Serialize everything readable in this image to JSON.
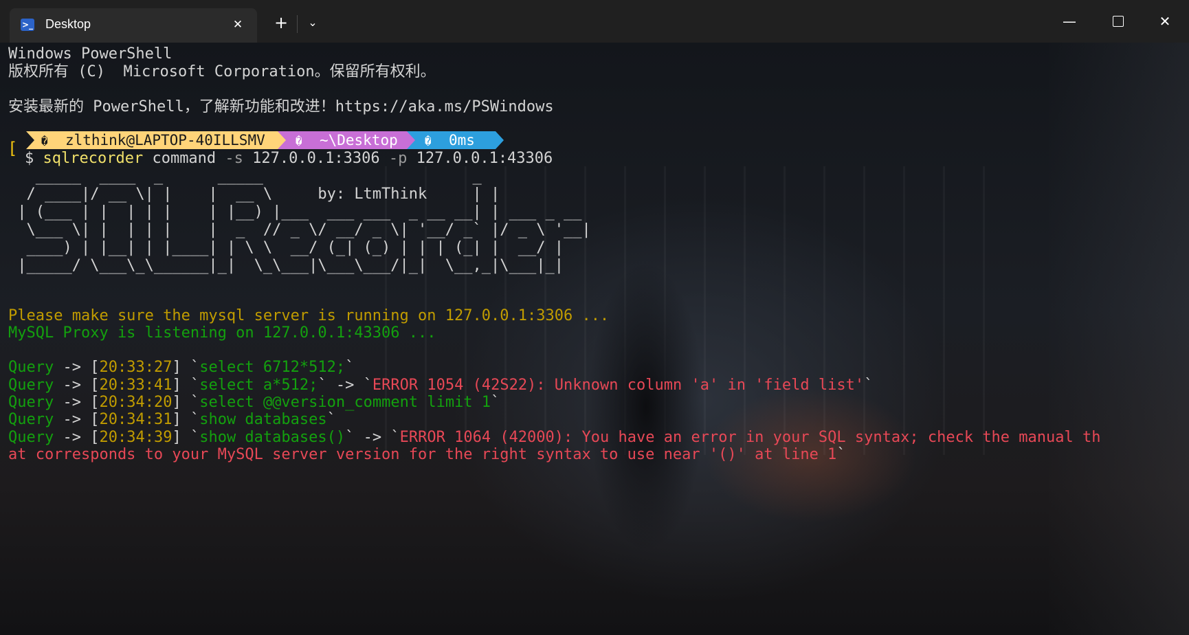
{
  "window": {
    "tab_title": "Desktop",
    "tab_icon": "powershell-icon",
    "tab_close": "✕",
    "new_tab": "+",
    "dropdown": "⌄",
    "minimize": "—",
    "close": "✕"
  },
  "terminal": {
    "header_lines": [
      "Windows PowerShell",
      "版权所有 (C)  Microsoft Corporation。保留所有权利。",
      "安装最新的 PowerShell，了解新功能和改进！https://aka.ms/PSWindows"
    ],
    "prompt": {
      "user_icon": "�",
      "user": "zlthink@LAPTOP-40ILLSMV",
      "path_icon": "�",
      "path": "~\\Desktop",
      "time_icon": "�",
      "time": "0ms",
      "colors": {
        "user": "#ffd479",
        "path": "#c86fd6",
        "time": "#2d9fde"
      }
    },
    "command": {
      "symbol": "$",
      "program": "sqlrecorder",
      "subcommand": "command",
      "flag_s": "-s",
      "arg_s": "127.0.0.1:3306",
      "flag_p": "-p",
      "arg_p": "127.0.0.1:43306"
    },
    "banner": "   _____  ____  _      _____                       _\n  / ____|/ __ \\| |    |  __ \\     by: LtmThink     | |\n | (___ | |  | | |    | |__) |___  ___ ___  _ __ __| | ___ _ __\n  \\___ \\| |  | | |    |  _  // _ \\/ __/ _ \\| '__/ _` |/ _ \\ '__|\n  ____) | |__| | |____| | \\ \\  __/ (_| (_) | | | (_| |  __/ |\n |_____/ \\___\\_\\______|_|  \\_\\___|\\___\\___/|_|  \\__,_|\\___|_|",
    "notice_line": "Please make sure the mysql server is running on 127.0.0.1:3306 ...",
    "listen_line": "MySQL Proxy is listening on 127.0.0.1:43306 ...",
    "queries": [
      {
        "label": "Query",
        "arrow": "->",
        "time": "20:33:27",
        "sql": "select 6712*512;",
        "error": ""
      },
      {
        "label": "Query",
        "arrow": "->",
        "time": "20:33:41",
        "sql": "select a*512;",
        "error": "ERROR 1054 (42S22): Unknown column 'a' in 'field list'"
      },
      {
        "label": "Query",
        "arrow": "->",
        "time": "20:34:20",
        "sql": "select @@version_comment limit 1",
        "error": ""
      },
      {
        "label": "Query",
        "arrow": "->",
        "time": "20:34:31",
        "sql": "show databases",
        "error": ""
      },
      {
        "label": "Query",
        "arrow": "->",
        "time": "20:34:39",
        "sql": "show databases()",
        "error": "ERROR 1064 (42000): You have an error in your SQL syntax; check the manual th"
      }
    ],
    "error_continuation": "at corresponds to your MySQL server version for the right syntax to use near '()' at line 1",
    "colors": {
      "yellow": "#c19c00",
      "green": "#13a10e",
      "red": "#e74856",
      "text": "#d4d4d4"
    }
  }
}
